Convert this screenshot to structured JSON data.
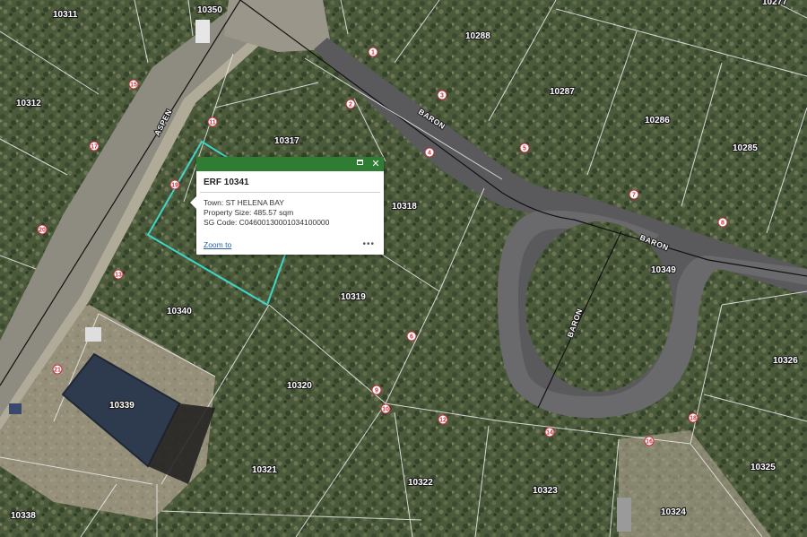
{
  "map": {
    "roads": [
      {
        "id": "aspen",
        "label": "ASPEN"
      },
      {
        "id": "baron-1",
        "label": "BARON"
      },
      {
        "id": "baron-2",
        "label": "BARON"
      },
      {
        "id": "baron-3",
        "label": "BARON"
      }
    ],
    "erfs": [
      "10311",
      "10350",
      "10277",
      "10288",
      "10312",
      "10287",
      "10286",
      "10285",
      "10317",
      "10318",
      "10349",
      "10340",
      "10319",
      "10326",
      "10339",
      "10320",
      "10321",
      "10322",
      "10323",
      "10325",
      "10324",
      "10338"
    ],
    "segment_numbers": [
      "1",
      "2",
      "3",
      "4",
      "5",
      "6",
      "7",
      "8",
      "9",
      "10",
      "11",
      "12",
      "13",
      "14",
      "15",
      "16",
      "17",
      "18",
      "19",
      "20",
      "21"
    ],
    "selected_parcel_color": "#3fd6c7",
    "parcel_line_color": "#e6e6e6"
  },
  "popup": {
    "header_color": "#2e7d32",
    "title": "ERF 10341",
    "lines": [
      "Town:  ST HELENA BAY",
      "Property Size: 485.57 sqm",
      "SG Code: C04600130001034100000"
    ],
    "zoom_label": "Zoom to",
    "more_label": "•••",
    "maximize_icon": "maximize-icon",
    "close_icon": "close-icon"
  }
}
